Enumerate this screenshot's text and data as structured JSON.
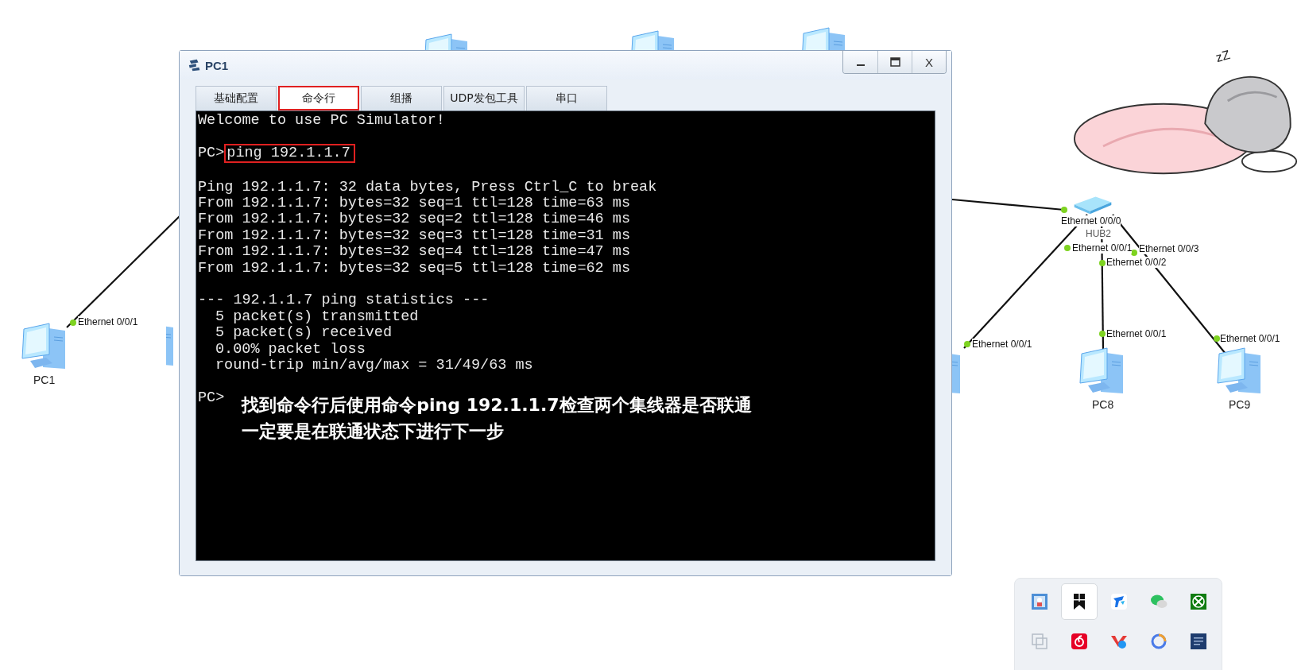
{
  "topology": {
    "devices": [
      {
        "label": "PC1"
      },
      {
        "label": "PC8"
      },
      {
        "label": "PC9"
      }
    ],
    "hub_label": "HUB2",
    "ports": [
      {
        "label": "Ethernet 0/0/1"
      },
      {
        "label": "Ethernet 0/0/0"
      },
      {
        "label": "Ethernet 0/0/1"
      },
      {
        "label": "Ethernet 0/0/3"
      },
      {
        "label": "Ethernet 0/0/2"
      },
      {
        "label": "Ethernet 0/0/1"
      },
      {
        "label": "Ethernet 0/0/1"
      },
      {
        "label": "Ethernet 0/0/1"
      }
    ]
  },
  "sticker": {
    "snore": "zZ"
  },
  "window": {
    "title": "PC1",
    "close": "X",
    "tabs": [
      {
        "label": "基础配置",
        "selected": false
      },
      {
        "label": "命令行",
        "selected": true
      },
      {
        "label": "组播",
        "selected": false
      },
      {
        "label": "UDP发包工具",
        "selected": false
      },
      {
        "label": "串口",
        "selected": false
      }
    ],
    "terminal": {
      "welcome": "Welcome to use PC Simulator!",
      "prompt": "PC>",
      "command": {
        "text": "ping 192.1.1.7",
        "highlighted": true
      },
      "ping_header": "Ping 192.1.1.7: 32 data bytes, Press Ctrl_C to break",
      "replies": [
        "From 192.1.1.7: bytes=32 seq=1 ttl=128 time=63 ms",
        "From 192.1.1.7: bytes=32 seq=2 ttl=128 time=46 ms",
        "From 192.1.1.7: bytes=32 seq=3 ttl=128 time=31 ms",
        "From 192.1.1.7: bytes=32 seq=4 ttl=128 time=47 ms",
        "From 192.1.1.7: bytes=32 seq=5 ttl=128 time=62 ms"
      ],
      "stats_title": "--- 192.1.1.7 ping statistics ---",
      "stats": [
        "5 packet(s) transmitted",
        "5 packet(s) received",
        "0.00% packet loss",
        "round-trip min/avg/max = 31/49/63 ms"
      ],
      "final_prompt": "PC>",
      "note": [
        "找到命令行后使用命令ping 192.1.1.7检查两个集线器是否联通",
        "一定要是在联通状态下进行下一步"
      ]
    }
  },
  "tray": {
    "items": [
      {
        "kind": "photo",
        "selected": false
      },
      {
        "kind": "bookmark",
        "selected": true
      },
      {
        "kind": "arrows",
        "selected": false
      },
      {
        "kind": "chat",
        "selected": false
      },
      {
        "kind": "xlogo",
        "selected": false
      },
      {
        "kind": "squares",
        "selected": false
      },
      {
        "kind": "swirl",
        "selected": false
      },
      {
        "kind": "vmark",
        "selected": false
      },
      {
        "kind": "ring",
        "selected": false
      },
      {
        "kind": "document",
        "selected": false
      }
    ]
  }
}
